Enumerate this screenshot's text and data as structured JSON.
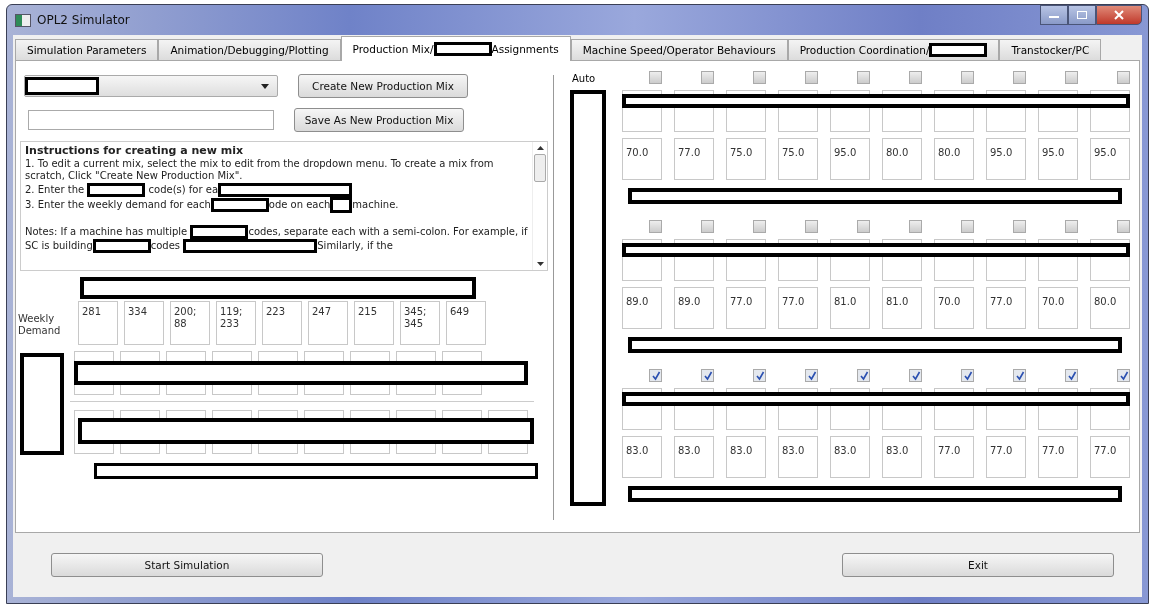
{
  "window": {
    "title": "OPL2 Simulator"
  },
  "tabs": [
    {
      "selected": false,
      "parts": [
        {
          "kind": "text",
          "text": "Simulation Parameters"
        }
      ]
    },
    {
      "selected": false,
      "parts": [
        {
          "kind": "text",
          "text": "Animation/Debugging/Plotting"
        }
      ]
    },
    {
      "selected": true,
      "parts": [
        {
          "kind": "text",
          "text": "Production Mix/"
        },
        {
          "kind": "redacted"
        },
        {
          "kind": "text",
          "text": "Assignments"
        }
      ]
    },
    {
      "selected": false,
      "parts": [
        {
          "kind": "text",
          "text": "Machine Speed/Operator Behaviours"
        }
      ]
    },
    {
      "selected": false,
      "parts": [
        {
          "kind": "text",
          "text": "Production Coordination/"
        },
        {
          "kind": "redacted"
        }
      ]
    },
    {
      "selected": false,
      "parts": [
        {
          "kind": "text",
          "text": "Transtocker/PC"
        }
      ]
    }
  ],
  "mix_panel": {
    "mix_dropdown": {
      "redacted": true
    },
    "create_button": "Create New Production Mix",
    "save_button": "Save As New Production Mix"
  },
  "instructions": {
    "title": "Instructions for creating a new mix",
    "paragraphs": [
      [
        {
          "kind": "text",
          "text": "1. To edit a current mix, select the mix to edit from the dropdown menu. To create a mix from scratch, Click \"Create New Production Mix\"."
        }
      ],
      [
        {
          "kind": "text",
          "text": "2. Enter the "
        },
        {
          "kind": "redacted"
        },
        {
          "kind": "text",
          "text": " code(s) for ea"
        },
        {
          "kind": "redacted_wide"
        }
      ],
      [
        {
          "kind": "text",
          "text": "3. Enter the weekly demand for each"
        },
        {
          "kind": "redacted"
        },
        {
          "kind": "text",
          "text": "ode on each"
        },
        {
          "kind": "redacted_small"
        },
        {
          "kind": "text",
          "text": "machine."
        }
      ],
      [
        {
          "kind": "text",
          "text": "Notes: If a machine has multiple "
        },
        {
          "kind": "redacted"
        },
        {
          "kind": "text",
          "text": "codes, separate each with a semi-colon. For example, if SC is building"
        },
        {
          "kind": "redacted"
        },
        {
          "kind": "text",
          "text": "codes "
        },
        {
          "kind": "redacted_wide"
        },
        {
          "kind": "text",
          "text": "Similarly, if the"
        }
      ]
    ]
  },
  "demand_grid": {
    "header_redacted": true,
    "label": "Weekly Demand",
    "values": [
      "281",
      "334",
      "200;\n88",
      "119;\n233",
      "223",
      "247",
      "215",
      "345;\n345",
      "649"
    ],
    "code_row": {
      "redacted": true,
      "fields": [
        {
          "kind": "empty"
        },
        {
          "kind": "empty"
        },
        {
          "kind": "empty"
        },
        {
          "kind": "empty"
        },
        {
          "kind": "empty"
        },
        {
          "kind": "empty"
        },
        {
          "kind": "empty"
        },
        {
          "kind": "empty"
        },
        {
          "kind": "empty"
        }
      ]
    },
    "side_label_redacted": true,
    "lower_row": {
      "redacted": true,
      "fields": [
        {
          "kind": "empty"
        },
        {
          "kind": "empty"
        },
        {
          "kind": "empty"
        },
        {
          "kind": "empty"
        },
        {
          "kind": "empty"
        },
        {
          "kind": "empty"
        },
        {
          "kind": "empty"
        },
        {
          "kind": "empty"
        },
        {
          "kind": "empty"
        },
        {
          "kind": "empty"
        }
      ]
    },
    "footer_redacted": true
  },
  "machine_panel": {
    "auto_label": "Auto",
    "side_label_redacted": true,
    "groups": [
      {
        "checks": [
          {
            "checked": false
          },
          {
            "checked": false
          },
          {
            "checked": false
          },
          {
            "checked": false
          },
          {
            "checked": false
          },
          {
            "checked": false
          },
          {
            "checked": false
          },
          {
            "checked": false
          },
          {
            "checked": false
          },
          {
            "checked": false
          }
        ],
        "name_row_redacted": true,
        "values": [
          "70.0",
          "77.0",
          "75.0",
          "75.0",
          "95.0",
          "80.0",
          "80.0",
          "95.0",
          "95.0",
          "95.0"
        ],
        "footer_redacted": true
      },
      {
        "checks": [
          {
            "checked": false
          },
          {
            "checked": false
          },
          {
            "checked": false
          },
          {
            "checked": false
          },
          {
            "checked": false
          },
          {
            "checked": false
          },
          {
            "checked": false
          },
          {
            "checked": false
          },
          {
            "checked": false
          },
          {
            "checked": false
          }
        ],
        "name_row_redacted": true,
        "values": [
          "89.0",
          "89.0",
          "77.0",
          "77.0",
          "81.0",
          "81.0",
          "70.0",
          "77.0",
          "70.0",
          "80.0"
        ],
        "footer_redacted": true
      },
      {
        "checks": [
          {
            "checked": true
          },
          {
            "checked": true
          },
          {
            "checked": true
          },
          {
            "checked": true
          },
          {
            "checked": true
          },
          {
            "checked": true
          },
          {
            "checked": true
          },
          {
            "checked": true
          },
          {
            "checked": true
          },
          {
            "checked": true
          }
        ],
        "name_row_redacted": true,
        "values": [
          "83.0",
          "83.0",
          "83.0",
          "83.0",
          "83.0",
          "83.0",
          "77.0",
          "77.0",
          "77.0",
          "77.0"
        ],
        "footer_redacted": true
      }
    ]
  },
  "buttons": [
    "Start Simulation",
    "Exit"
  ]
}
